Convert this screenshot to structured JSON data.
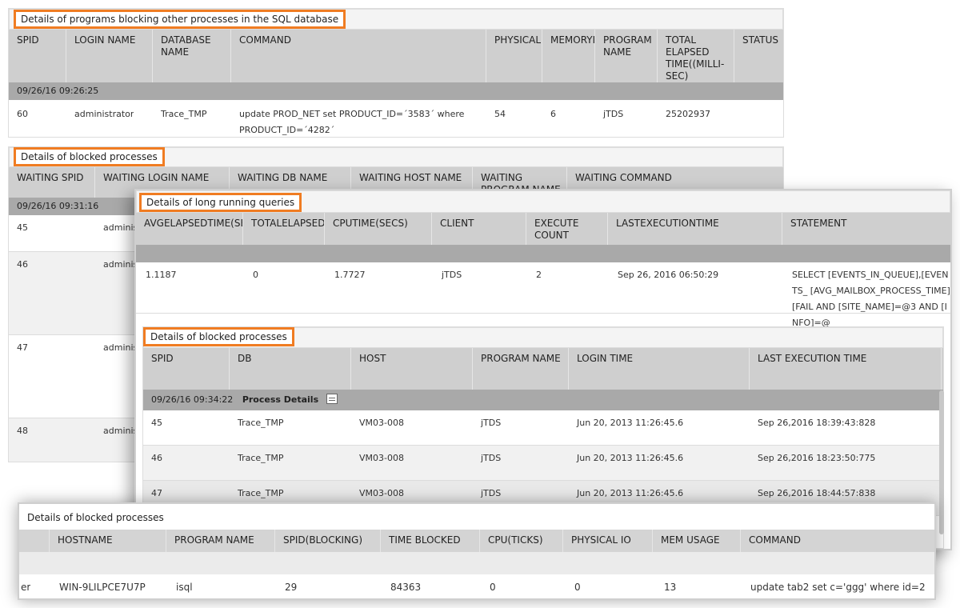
{
  "panel1": {
    "title": "Details of programs blocking other processes in the SQL database",
    "headers": [
      "SPID",
      "LOGIN NAME",
      "DATABASE NAME",
      "COMMAND",
      "PHYSICALI",
      "MEMORYI",
      "PROGRAM NAME",
      "TOTAL ELAPSED TIME((MILLI-SEC)",
      "STATUS"
    ],
    "group": "09/26/16 09:26:25",
    "row": [
      "60",
      "administrator",
      "Trace_TMP",
      "update PROD_NET set PRODUCT_ID=´3583´ where PRODUCT_ID=´4282´",
      "54",
      "6",
      "jTDS",
      "25202937",
      ""
    ]
  },
  "panel2": {
    "title": "Details of blocked processes",
    "headers": [
      "WAITING SPID",
      "WAITING LOGIN NAME",
      "WAITING DB NAME",
      "WAITING HOST NAME",
      "WAITING PROGRAM NAME",
      "WAITING COMMAND"
    ],
    "group": "09/26/16 09:31:16",
    "rows": [
      [
        "45",
        "adminis"
      ],
      [
        "46",
        "adminis"
      ],
      [
        "47",
        "adminis"
      ],
      [
        "48",
        "adminis"
      ]
    ]
  },
  "panel3": {
    "title": "Details of long running queries",
    "headers": [
      "AVGELAPSEDTIME(SE",
      "TOTALELAPSED",
      "CPUTIME(SECS)",
      "CLIENT",
      "EXECUTE COUNT",
      "LASTEXECUTIONTIME",
      "STATEMENT"
    ],
    "row": [
      "1.1187",
      "0",
      "1.7727",
      "jTDS",
      "2",
      "Sep 26, 2016 06:50:29",
      "SELECT [EVENTS_IN_QUEUE],[EVENTS_ [AVG_MAILBOX_PROCESS_TIME],[FAIL AND [SITE_NAME]=@3 AND [INFO]=@"
    ],
    "sub_title": "Details of blocked processes",
    "sub_headers": [
      "SPID",
      "DB",
      "HOST",
      "PROGRAM NAME",
      "LOGIN TIME",
      "LAST EXECUTION TIME"
    ],
    "sub_group": "09/26/16 09:34:22",
    "sub_group_label": "Process Details",
    "sub_rows": [
      [
        "45",
        "Trace_TMP",
        "VM03-008",
        "jTDS",
        "Jun 20, 2013 11:26:45.6",
        "Sep 26,2016 18:39:43:828"
      ],
      [
        "46",
        "Trace_TMP",
        "VM03-008",
        "jTDS",
        "Jun 20, 2013 11:26:45.6",
        "Sep 26,2016 18:23:50:775"
      ],
      [
        "47",
        "Trace_TMP",
        "VM03-008",
        "jTDS",
        "Jun 20, 2013 11:26:45.6",
        "Sep 26,2016 18:44:57:838"
      ]
    ]
  },
  "panel4": {
    "title": "Details of blocked processes",
    "headers": [
      "",
      "HOSTNAME",
      "PROGRAM NAME",
      "SPID(BLOCKING)",
      "TIME BLOCKED",
      "CPU(TICKS)",
      "PHYSICAL IO",
      "MEM USAGE",
      "COMMAND"
    ],
    "row": [
      "er",
      "WIN-9LILPCE7U7P",
      "isql",
      "29",
      "84363",
      "0",
      "0",
      "13",
      "update tab2 set c='ggg' where id=2"
    ]
  },
  "colors": {
    "accent": "#f07c22",
    "header_bg": "#cfcfcf",
    "group_bg": "#a9a9a9"
  }
}
